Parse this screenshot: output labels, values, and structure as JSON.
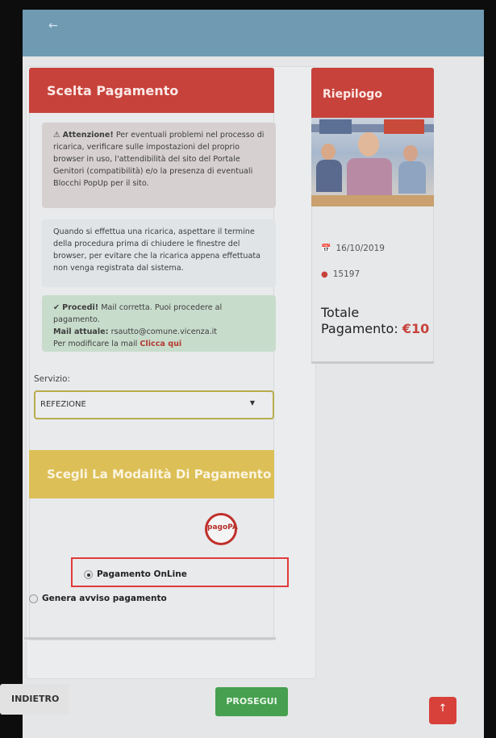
{
  "top_bar": {
    "back_icon": "arrow-left-icon"
  },
  "payment_card": {
    "title": "Scelta Pagamento",
    "warning": {
      "strong": "Attenzione!",
      "text": " Per eventuali problemi nel processo di ricarica, verificare sulle impostazioni del proprio browser in uso, l'attendibilità del sito del Portale Genitori (compatibilità) e/o la presenza di eventuali Blocchi PopUp per il sito."
    },
    "info": "Quando si effettua una ricarica, aspettare il termine della procedura prima di chiudere le finestre del browser, per evitare che la ricarica appena effettuata non venga registrata dal sistema.",
    "success": {
      "strong": "Procedi!",
      "text": " Mail corretta. Puoi procedere al pagamento.",
      "mail_label": "Mail attuale:",
      "mail_value": " rsautto@comune.vicenza.it",
      "modify_text": "Per modificare la mail ",
      "modify_link": "Clicca qui"
    },
    "service_label": "Servizio:",
    "service_selected": "REFEZIONE",
    "payment_mode_title": "Scegli La Modalità Di Pagamento",
    "pagopa_logo": "pagoPA",
    "options": [
      {
        "label": "Pagamento OnLine",
        "selected": true
      },
      {
        "label": "Genera avviso pagamento",
        "selected": false
      }
    ]
  },
  "summary": {
    "title": "Riepilogo",
    "date": "16/10/2019",
    "count": "15197",
    "total_label": "Totale",
    "total_label2": "Pagamento:",
    "total_amount": "€10"
  },
  "buttons": {
    "back": "INDIETRO",
    "next": "PROSEGUI",
    "scroll_top_icon": "arrow-up-icon"
  },
  "colors": {
    "header_red": "#c7423b",
    "header_yellow": "#dcbf57",
    "button_green": "#46a04f",
    "top_bar": "#6f9ab2"
  }
}
